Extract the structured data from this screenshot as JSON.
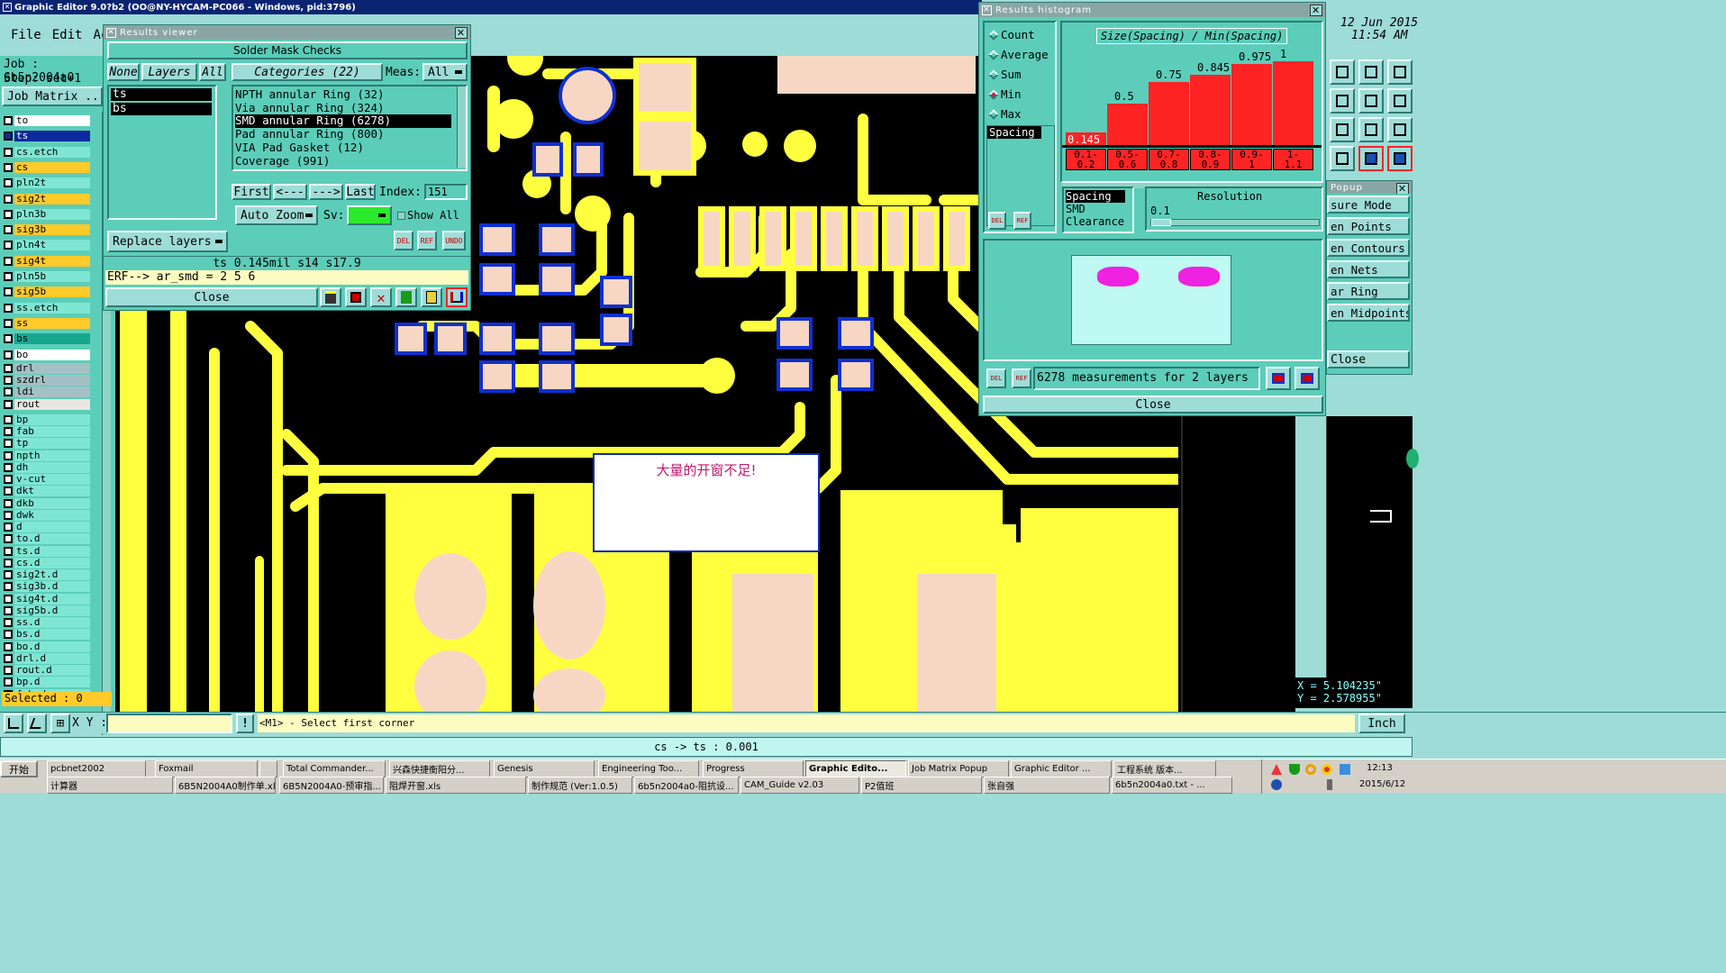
{
  "window": {
    "title": "Graphic Editor 9.0?b2 (OO@NY-HYCAM-PC066 - Windows, pid:3796)"
  },
  "menu": [
    "File",
    "Edit",
    "Actior"
  ],
  "job": {
    "job_label": "Job : 6b5n2004a0",
    "step_label": "Step: set+1",
    "matrix_button": "Job Matrix ..."
  },
  "layers": [
    {
      "name": "to",
      "color": "#ffffff"
    },
    {
      "name": "ts",
      "color": "#0c2a9e",
      "selected": true
    },
    {
      "name": "cs.etch",
      "color": "#7fe6d4"
    },
    {
      "name": "cs",
      "color": "#ffca2a"
    },
    {
      "name": "pln2t",
      "color": "#7fe6d4"
    },
    {
      "name": "sig2t",
      "color": "#ffca2a"
    },
    {
      "name": "pln3b",
      "color": "#7fe6d4"
    },
    {
      "name": "sig3b",
      "color": "#ffca2a"
    },
    {
      "name": "pln4t",
      "color": "#7fe6d4"
    },
    {
      "name": "sig4t",
      "color": "#ffca2a"
    },
    {
      "name": "pln5b",
      "color": "#7fe6d4"
    },
    {
      "name": "sig5b",
      "color": "#ffca2a"
    },
    {
      "name": "ss.etch",
      "color": "#7fe6d4"
    },
    {
      "name": "ss",
      "color": "#ffca2a"
    },
    {
      "name": "bs",
      "color": "#16a88f"
    },
    {
      "name": "bo",
      "color": "#ffffff"
    },
    {
      "name": "drl",
      "color": "#a4c0c4"
    },
    {
      "name": "szdrl",
      "color": "#a4c0c4"
    },
    {
      "name": "ldi",
      "color": "#a4c0c4"
    },
    {
      "name": "rout",
      "color": "#e8e6e0"
    },
    {
      "name": "bp",
      "color": "#7fe6d4"
    },
    {
      "name": "fab",
      "color": "#7fe6d4"
    },
    {
      "name": "tp",
      "color": "#7fe6d4"
    },
    {
      "name": "npth",
      "color": "#7fe6d4"
    },
    {
      "name": "dh",
      "color": "#7fe6d4"
    },
    {
      "name": "v-cut",
      "color": "#7fe6d4"
    },
    {
      "name": "dkt",
      "color": "#7fe6d4"
    },
    {
      "name": "dkb",
      "color": "#7fe6d4"
    },
    {
      "name": "dwk",
      "color": "#7fe6d4"
    },
    {
      "name": "d",
      "color": "#7fe6d4"
    },
    {
      "name": "to.d",
      "color": "#7fe6d4"
    },
    {
      "name": "ts.d",
      "color": "#7fe6d4"
    },
    {
      "name": "cs.d",
      "color": "#7fe6d4"
    },
    {
      "name": "sig2t.d",
      "color": "#7fe6d4"
    },
    {
      "name": "sig3b.d",
      "color": "#7fe6d4"
    },
    {
      "name": "sig4t.d",
      "color": "#7fe6d4"
    },
    {
      "name": "sig5b.d",
      "color": "#7fe6d4"
    },
    {
      "name": "ss.d",
      "color": "#7fe6d4"
    },
    {
      "name": "bs.d",
      "color": "#7fe6d4"
    },
    {
      "name": "bo.d",
      "color": "#7fe6d4"
    },
    {
      "name": "drl.d",
      "color": "#7fe6d4"
    },
    {
      "name": "rout.d",
      "color": "#7fe6d4"
    },
    {
      "name": "bp.d",
      "color": "#7fe6d4"
    },
    {
      "name": "fab.d",
      "color": "#7fe6d4"
    }
  ],
  "selected_label": "Selected : 0",
  "results_viewer": {
    "title": "Results viewer",
    "heading": "Solder Mask Checks",
    "none_btn": "None",
    "layers_btn": "Layers",
    "all_btn": "All",
    "categories_btn": "Categories (22)",
    "meas_label": "Meas:",
    "meas_value": "All",
    "layer_list": [
      "ts",
      "bs"
    ],
    "categories": [
      "NPTH annular Ring (32)",
      "Via annular Ring (324)",
      "SMD annular Ring (6278)",
      "Pad annular Ring (800)",
      "VIA Pad Gasket (12)",
      "Coverage (991)"
    ],
    "first": "First",
    "prev": "<---",
    "next": "--->",
    "last": "Last",
    "index_label": "Index:",
    "index_value": "151",
    "auto_zoom": "Auto Zoom",
    "sv_label": "Sv:",
    "show_all": "Show All",
    "replace_layers": "Replace layers",
    "del": "DEL",
    "ref": "REF",
    "undo": "UNDO",
    "status": "ts 0.145mil s14 s17.9",
    "erf": "ERF--> ar_smd = 2 5 6",
    "close": "Close"
  },
  "histogram": {
    "title": "Results histogram",
    "axis_title": "Size(Spacing) / Min(Spacing)",
    "radio": [
      "Count",
      "Average",
      "Sum",
      "Min",
      "Max"
    ],
    "radio_selected": "Min",
    "list_item": "Spacing",
    "list2": [
      "Spacing",
      "SMD",
      "Clearance"
    ],
    "resolution_label": "Resolution",
    "resolution_value": "0.1",
    "measurements": "6278 measurements for 2 layers",
    "close": "Close",
    "del": "DEL",
    "ref": "REF"
  },
  "chart_data": {
    "type": "bar",
    "title": "Size(Spacing) / Min(Spacing)",
    "categories": [
      "0.1-0.2",
      "0.5-0.6",
      "0.7-0.8",
      "0.8-0.9",
      "0.9-1",
      "1-1.1"
    ],
    "values": [
      0.145,
      0.5,
      0.75,
      0.845,
      0.975,
      1
    ],
    "value_labels": [
      "0.145",
      "0.5",
      "0.75",
      "0.845",
      "0.975",
      "1"
    ],
    "category_labels": [
      [
        "0.1-",
        "0.2"
      ],
      [
        "0.5-",
        "0.6"
      ],
      [
        "0.7-",
        "0.8"
      ],
      [
        "0.8-",
        "0.9"
      ],
      [
        "0.9-",
        "1"
      ],
      [
        "1-",
        "1.1"
      ]
    ],
    "ylim": [
      0,
      1.4
    ],
    "bar_color": "#ff2424"
  },
  "popup": {
    "title": "Popup",
    "items": [
      "sure Mode",
      "en Points",
      "en Contours",
      "en Nets",
      "ar Ring",
      "en Midpoints"
    ],
    "close": "Close"
  },
  "clock": {
    "date": "12 Jun 2015",
    "time": "11:54 AM"
  },
  "annotation": "大量的开窗不足!",
  "coords": {
    "x": "X = 5.104235\"",
    "y": "Y = 2.578955\""
  },
  "bottom": {
    "xy_label": "X Y :",
    "prompt": "<M1> - Select first corner",
    "units": "Inch",
    "status": "cs -> ts : 0.001"
  },
  "taskbar": {
    "start": "开始",
    "row1": [
      "pcbnet2002",
      "Foxmail",
      "",
      "Total Commander...",
      "兴森快捷衡阳分...",
      "Genesis",
      "Engineering Too...",
      "Progress",
      "Graphic Edito...",
      "Job Matrix Popup",
      "Graphic Editor ...",
      "工程系统   版本..."
    ],
    "row2": [
      "计算器",
      "6B5N2004A0制作单.xls",
      "6B5N2004A0-预审指...",
      "阻焊开窗.xls",
      "制作规范 (Ver:1.0.5)",
      "6b5n2004a0-阻抗设...",
      "CAM_Guide v2.03",
      "P2值班",
      "张自强",
      "6b5n2004a0.txt - ..."
    ],
    "time": "12:13",
    "date": "2015/6/12"
  }
}
